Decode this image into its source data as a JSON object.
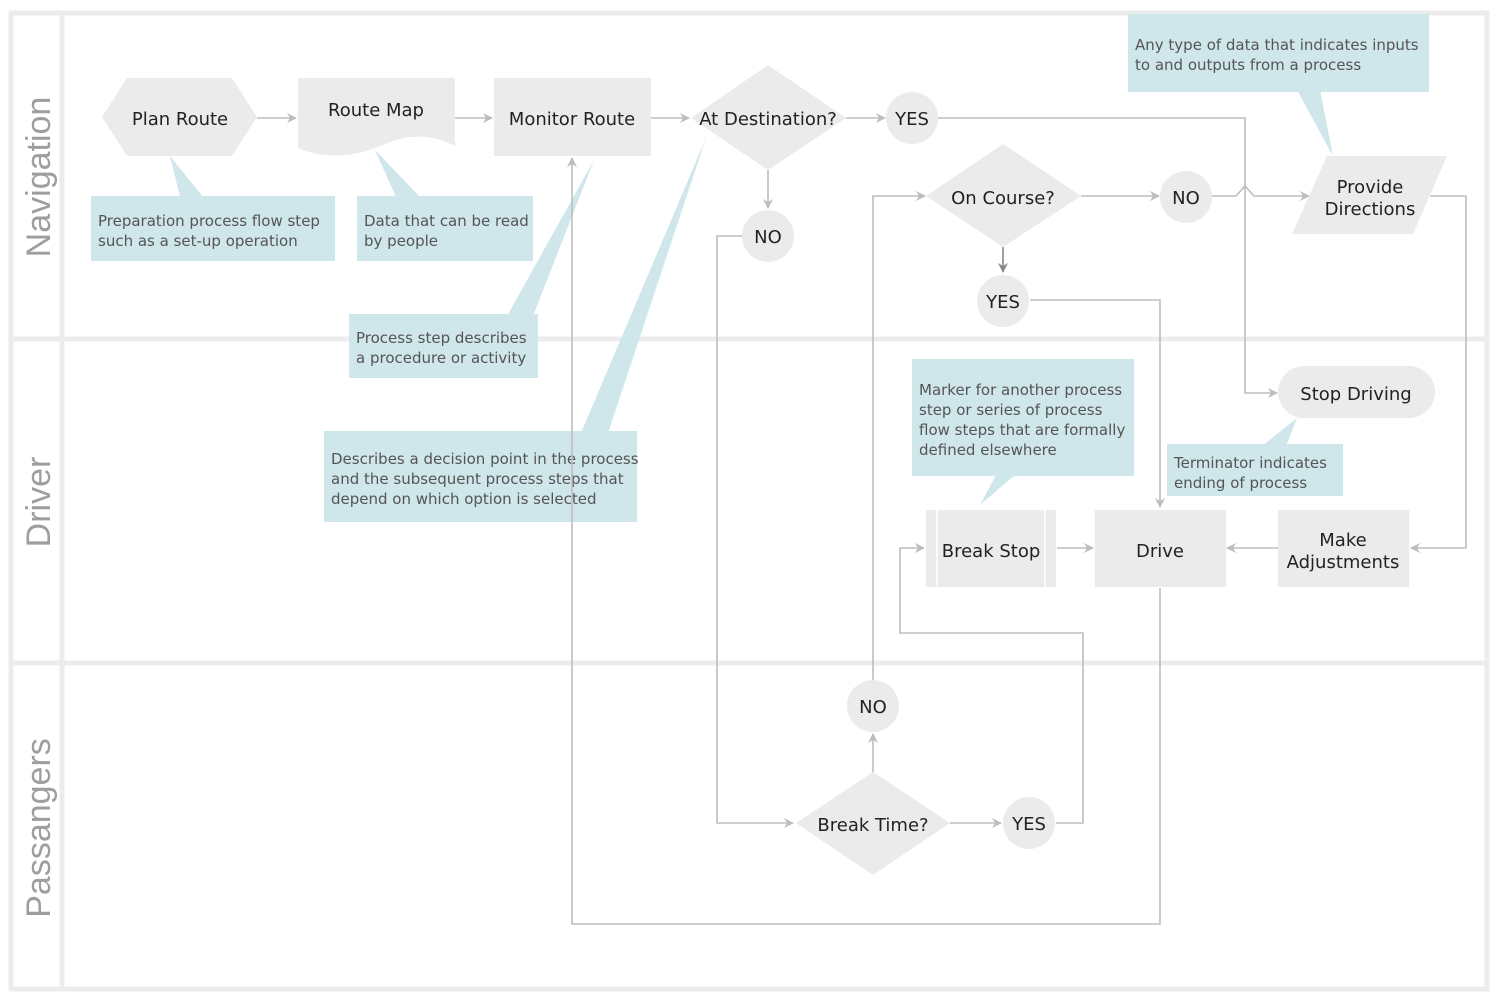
{
  "diagram": {
    "type": "cross-functional flowchart",
    "colors": {
      "shape_fill": "#ebebeb",
      "callout_fill": "#cfe6eb",
      "connector": "#bdbdbd",
      "lane_border": "#ececec",
      "lane_label": "#9e9e9e"
    },
    "lanes": [
      {
        "id": "navigation",
        "label": "Navigation"
      },
      {
        "id": "driver",
        "label": "Driver"
      },
      {
        "id": "passengers",
        "label": "Passangers"
      }
    ],
    "nodes": {
      "plan_route": {
        "label": "Plan Route",
        "shape": "preparation",
        "lane": "navigation"
      },
      "route_map": {
        "label": "Route Map",
        "shape": "document",
        "lane": "navigation"
      },
      "monitor_route": {
        "label": "Monitor Route",
        "shape": "process",
        "lane": "navigation"
      },
      "at_destination": {
        "label": "At Destination?",
        "shape": "decision",
        "lane": "navigation"
      },
      "yes_destination": {
        "label": "YES",
        "shape": "connector",
        "lane": "navigation"
      },
      "no_destination": {
        "label": "NO",
        "shape": "connector",
        "lane": "navigation"
      },
      "on_course": {
        "label": "On Course?",
        "shape": "decision",
        "lane": "navigation"
      },
      "no_course": {
        "label": "NO",
        "shape": "connector",
        "lane": "navigation"
      },
      "yes_course": {
        "label": "YES",
        "shape": "connector",
        "lane": "navigation"
      },
      "provide_directions": {
        "label_line1": "Provide",
        "label_line2": "Directions",
        "shape": "data",
        "lane": "navigation"
      },
      "stop_driving": {
        "label": "Stop Driving",
        "shape": "terminator",
        "lane": "driver"
      },
      "break_stop": {
        "label": "Break Stop",
        "shape": "predefined-process",
        "lane": "driver"
      },
      "drive": {
        "label": "Drive",
        "shape": "process",
        "lane": "driver"
      },
      "make_adjustments": {
        "label_line1": "Make",
        "label_line2": "Adjustments",
        "shape": "process",
        "lane": "driver"
      },
      "no_break": {
        "label": "NO",
        "shape": "connector",
        "lane": "passengers"
      },
      "break_time": {
        "label": "Break Time?",
        "shape": "decision",
        "lane": "passengers"
      },
      "yes_break": {
        "label": "YES",
        "shape": "connector",
        "lane": "passengers"
      }
    },
    "callouts": {
      "preparation": {
        "lines": [
          "Preparation process flow step",
          "such as a set-up operation"
        ]
      },
      "document": {
        "lines": [
          "Data that can be read",
          "by people"
        ]
      },
      "process": {
        "lines": [
          "Process step describes",
          "a procedure or activity"
        ]
      },
      "decision": {
        "lines": [
          "Describes a decision point in the process",
          "and the subsequent process steps that",
          "depend on which option is selected"
        ]
      },
      "data": {
        "lines": [
          "Any type of data that indicates inputs",
          "to and outputs from a process"
        ]
      },
      "predefined": {
        "lines": [
          "Marker for another process",
          "step or series of process",
          "flow steps that are formally",
          "defined elsewhere"
        ]
      },
      "terminator": {
        "lines": [
          "Terminator indicates",
          "ending of process"
        ]
      }
    }
  }
}
